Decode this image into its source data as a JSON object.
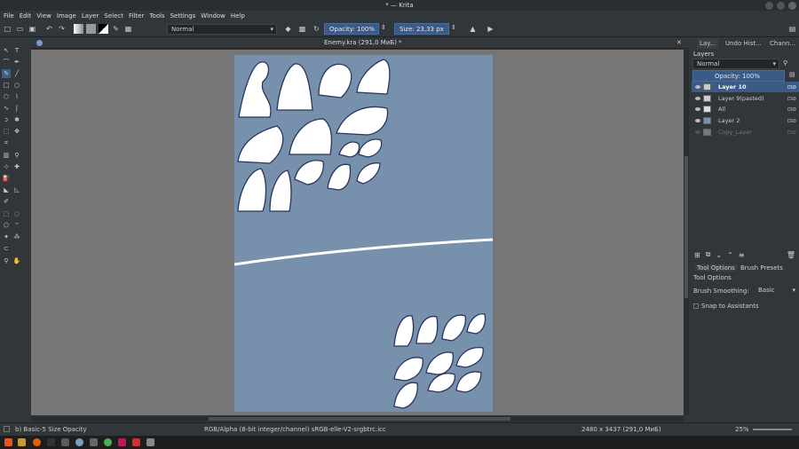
{
  "window": {
    "title": "* — Krita"
  },
  "menu": [
    "File",
    "Edit",
    "View",
    "Image",
    "Layer",
    "Select",
    "Filter",
    "Tools",
    "Settings",
    "Window",
    "Help"
  ],
  "toolbar": {
    "blend_mode": "Normal",
    "opacity": "Opacity: 100%",
    "size": "Size: 23,33 px"
  },
  "document": {
    "tab_title": "Enemy.kra (291,0 МиБ) *"
  },
  "dock": {
    "tabs": [
      "Lay...",
      "Undo Hist...",
      "Chann..."
    ],
    "layers_title": "Layers",
    "blend": "Normal",
    "opacity": "Opacity:  100%",
    "layers": [
      {
        "name": "Layer 10",
        "selected": true
      },
      {
        "name": "Layer 9(pasted)",
        "selected": false
      },
      {
        "name": "All",
        "selected": false
      },
      {
        "name": "Layer 2",
        "selected": false
      },
      {
        "name": "Copy_Layer",
        "selected": false
      }
    ],
    "tool_tabs": [
      "Tool Options",
      "Brush Presets"
    ],
    "tool_options_title": "Tool Options",
    "smoothing_label": "Brush Smoothing:",
    "smoothing_value": "Basic",
    "snap_label": "Snap to Assistants"
  },
  "status": {
    "brush": "b) Basic-5 Size Opacity",
    "color_info": "RGB/Alpha (8-bit integer/channel)  sRGB-elle-V2-srgbtrc.icc",
    "dimensions": "2480 x 3437 (291,0 МиБ)",
    "zoom": "25%"
  },
  "colors": {
    "accent": "#3b5a85",
    "page": "#7790ab",
    "bg": "#31363b"
  }
}
